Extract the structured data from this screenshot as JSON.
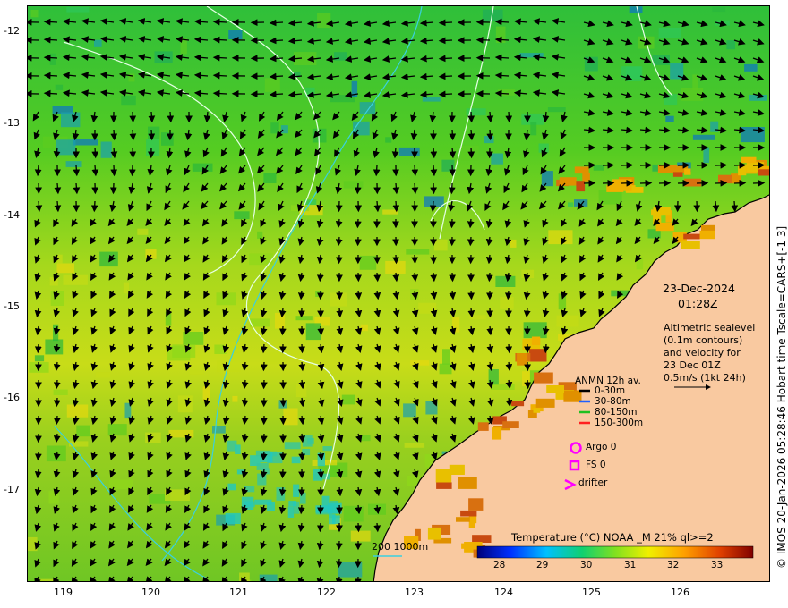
{
  "map": {
    "lat_ticks": [
      "-12",
      "-13",
      "-14",
      "-15",
      "-16",
      "-17"
    ],
    "lon_ticks": [
      "119",
      "120",
      "121",
      "122",
      "123",
      "124",
      "125",
      "126"
    ],
    "date": "23-Dec-2024",
    "time": "01:28Z",
    "altimetry_lines": [
      "Altimetric sealevel",
      "(0.1m contours)",
      "and velocity for",
      "23 Dec 01Z",
      "0.5m/s (1kt 24h)"
    ],
    "credit": "© IMOS 20-Jan-2026 05:28:46 Hobart time Tscale=CARS+[-1 3]",
    "isobath_label": "200  1000m",
    "land_color": "#f9c9a0",
    "coast_color": "#000000",
    "contour_color": "#e6ffe6",
    "isobath_color": "#3ad0e0"
  },
  "anmn_legend": {
    "title": "ANMN 12h av.",
    "items": [
      {
        "label": "0-30m",
        "color": "#000000"
      },
      {
        "label": "30-80m",
        "color": "#2060ff"
      },
      {
        "label": "80-150m",
        "color": "#20c020"
      },
      {
        "label": "150-300m",
        "color": "#ff2020"
      }
    ]
  },
  "obs_legend": {
    "argo": "Argo 0",
    "fs": "FS 0",
    "drifter": "drifter",
    "marker_color": "#ff00ff"
  },
  "colorbar": {
    "title": "Temperature (°C) NOAA _M 21% ql>=2",
    "ticks": [
      "28",
      "29",
      "30",
      "31",
      "32",
      "33"
    ],
    "range": [
      27.5,
      33.8
    ]
  }
}
